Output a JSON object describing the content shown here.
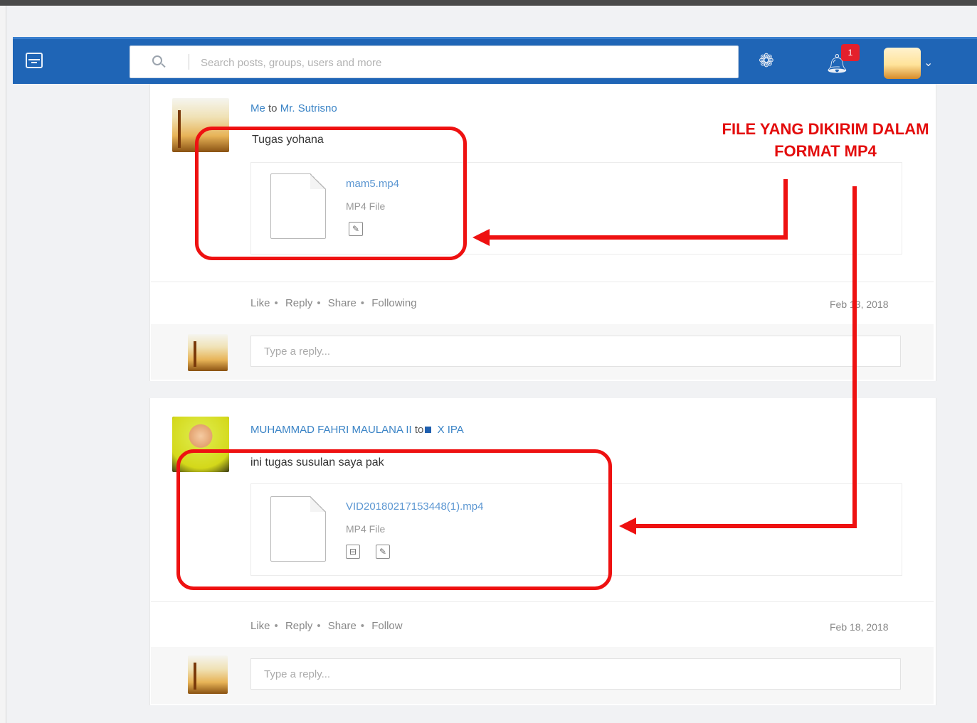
{
  "header": {
    "search_placeholder": "Search posts, groups, users and more",
    "notification_count": "1"
  },
  "posts": [
    {
      "author": "Me",
      "to_label": "to",
      "recipient": "Mr. Sutrisno",
      "message": "Tugas yohana",
      "file_name": "mam5.mp4",
      "file_type": "MP4 File",
      "actions": [
        "Like",
        "Reply",
        "Share",
        "Following"
      ],
      "date": "Feb 13, 2018",
      "reply_placeholder": "Type a reply..."
    },
    {
      "author": "MUHAMMAD FAHRI MAULANA II",
      "to_label": "to",
      "recipient": "X IPA",
      "message": "ini tugas susulan saya pak",
      "file_name": "VID20180217153448(1).mp4",
      "file_type": "MP4 File",
      "actions": [
        "Like",
        "Reply",
        "Share",
        "Follow"
      ],
      "date": "Feb 18, 2018",
      "reply_placeholder": "Type a reply..."
    }
  ],
  "annotation": {
    "line1": "FILE YANG DIKIRIM DALAM",
    "line2": "FORMAT MP4",
    "color": "#e30c0c"
  },
  "colors": {
    "navbar": "#1f65b6",
    "link": "#3b84c6",
    "badge": "#e4202c"
  }
}
